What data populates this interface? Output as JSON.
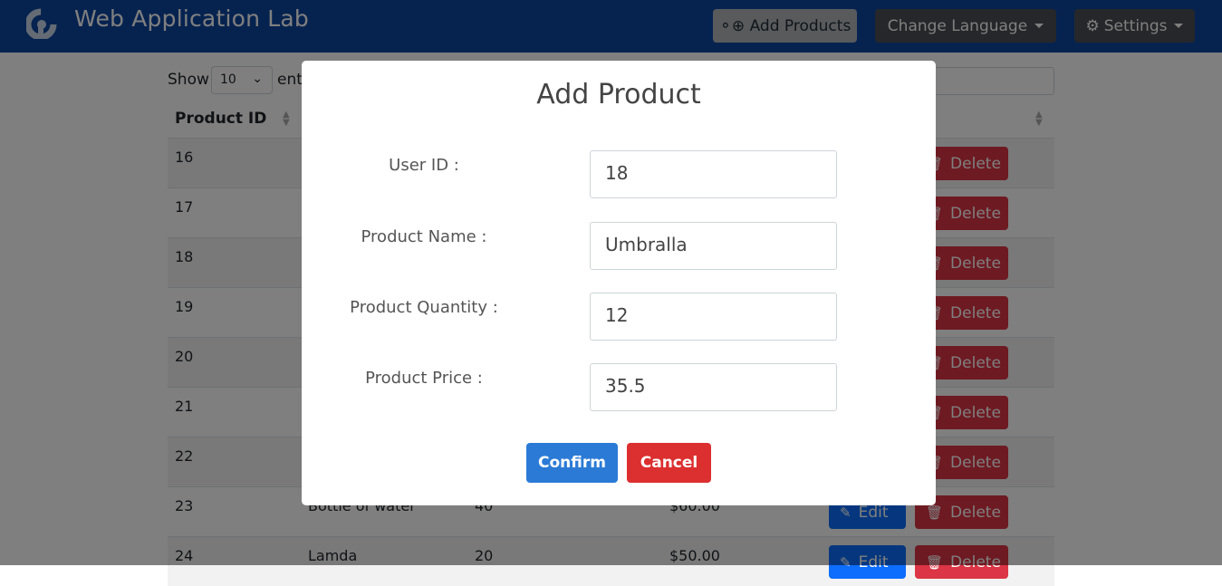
{
  "navbar": {
    "title": "Web Application Lab",
    "logo_icon": "app-logo-icon",
    "add_products_label": "⚬⊕ Add Products",
    "change_language_label": "Change Language",
    "settings_label": "Settings",
    "settings_icon": "gear-icon",
    "color": "#0d47a1"
  },
  "table_controls": {
    "show_label": "Show",
    "show_value": "10",
    "entries_label": "ent"
  },
  "table": {
    "headers": [
      "Product ID"
    ],
    "edit_label": "Edit",
    "delete_label": "Delete",
    "rows": [
      {
        "id": "16",
        "name": "",
        "qty": "",
        "price": ""
      },
      {
        "id": "17",
        "name": "",
        "qty": "",
        "price": ""
      },
      {
        "id": "18",
        "name": "",
        "qty": "",
        "price": ""
      },
      {
        "id": "19",
        "name": "",
        "qty": "",
        "price": ""
      },
      {
        "id": "20",
        "name": "",
        "qty": "",
        "price": ""
      },
      {
        "id": "21",
        "name": "",
        "qty": "",
        "price": ""
      },
      {
        "id": "22",
        "name": "",
        "qty": "",
        "price": ""
      },
      {
        "id": "23",
        "name": "Bottle of water",
        "qty": "40",
        "price": "$60.00"
      },
      {
        "id": "24",
        "name": "Lamda",
        "qty": "20",
        "price": "$50.00"
      }
    ]
  },
  "modal": {
    "title": "Add Product",
    "fields": [
      {
        "label": "User ID :",
        "value": "18"
      },
      {
        "label": "Product Name :",
        "value": "Umbralla"
      },
      {
        "label": "Product Quantity :",
        "value": "12"
      },
      {
        "label": "Product Price :",
        "value": "35.5"
      }
    ],
    "confirm_label": "Confirm",
    "cancel_label": "Cancel"
  }
}
